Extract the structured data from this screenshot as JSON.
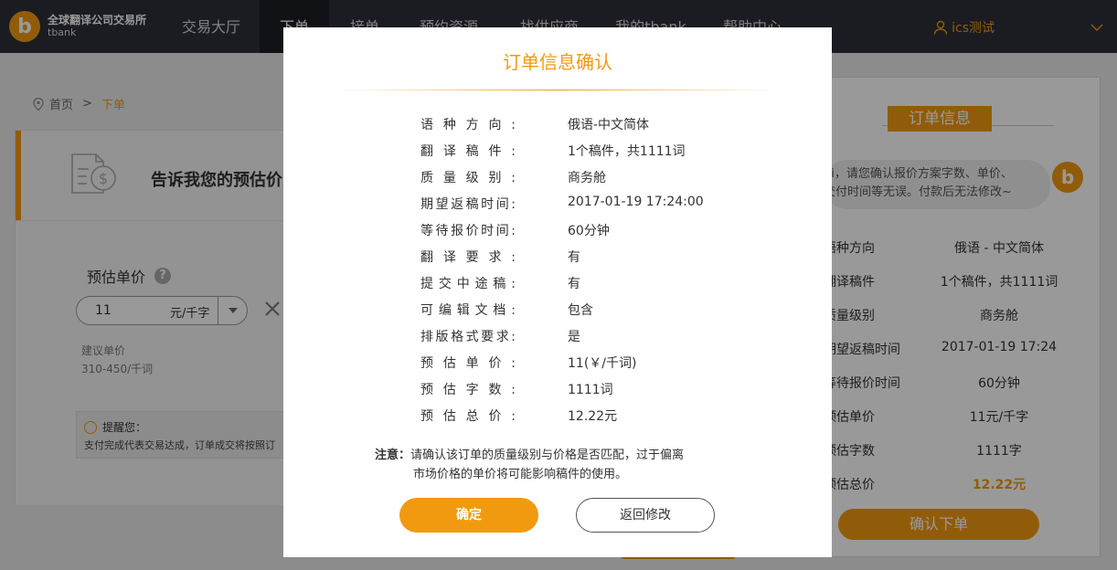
{
  "brand": {
    "logo_glyph": "b",
    "name_cn": "全球翻译公司交易所",
    "name_en": "tbank",
    "accent": "#f29a0f"
  },
  "nav": {
    "items": [
      {
        "label": "交易大厅"
      },
      {
        "label": "下单"
      },
      {
        "label": "接单"
      },
      {
        "label": "预约资源"
      },
      {
        "label": "找供应商"
      },
      {
        "label": "我的tbank"
      },
      {
        "label": "帮助中心"
      }
    ],
    "active_index": 1,
    "user": "ics测试"
  },
  "breadcrumb": {
    "home": "首页",
    "sep": ">",
    "current": "下单"
  },
  "left": {
    "hero_title": "告诉我您的预估价",
    "price_label": "预估单价",
    "price_value": "11",
    "price_unit": "元/千字",
    "suggest_label": "建议单价",
    "suggest_range": "310-450/千词",
    "reminder_title": "提醒您：",
    "reminder_text": "支付完成代表交易达成，订单成交将按照订"
  },
  "right": {
    "title": "订单信息",
    "bubble_line1": "hi，请您确认报价方案字数、单价、",
    "bubble_line2": "交付时间等无误。付款后无法修改~",
    "rows": [
      {
        "k": "语种方向",
        "v": "俄语 - 中文简体"
      },
      {
        "k": "翻译稿件",
        "v": "1个稿件，共1111词"
      },
      {
        "k": "质量级别",
        "v": "商务舱"
      },
      {
        "k": "期望返稿时间",
        "v": "2017-01-19 17:24"
      },
      {
        "k": "等待报价时间",
        "v": "60分钟"
      },
      {
        "k": "预估单价",
        "v": "11元/千字"
      },
      {
        "k": "预估字数",
        "v": "1111字"
      },
      {
        "k": "预估总价",
        "v": "12.22元"
      }
    ],
    "confirm_label": "确认下单"
  },
  "modal": {
    "title": "订单信息确认",
    "rows": [
      {
        "k": "语种方向:",
        "v": "俄语-中文简体"
      },
      {
        "k": "翻译稿件:",
        "v": "1个稿件，共1111词"
      },
      {
        "k": "质量级别:",
        "v": "商务舱"
      },
      {
        "k": "期望返稿时间:",
        "v": "2017-01-19 17:24:00"
      },
      {
        "k": "等待报价时间:",
        "v": "60分钟"
      },
      {
        "k": "翻译要求:",
        "v": "有"
      },
      {
        "k": "提交中途稿:",
        "v": "有"
      },
      {
        "k": "可编辑文档:",
        "v": "包含"
      },
      {
        "k": "排版格式要求:",
        "v": "是"
      },
      {
        "k": "预估单价:",
        "v": "11(￥/千词)"
      },
      {
        "k": "预估字数:",
        "v": "1111词"
      },
      {
        "k": "预估总价:",
        "v": "12.22元"
      }
    ],
    "note_label": "注意：",
    "note_line1": "请确认该订单的质量级别与价格是否匹配，过于偏离",
    "note_line2": "市场价格的单价将可能影响稿件的使用。",
    "ok_label": "确定",
    "back_label": "返回修改"
  },
  "icons": [
    "location-pin-icon",
    "help-icon",
    "close-icon",
    "chevron-down-icon",
    "user-icon",
    "smile-icon",
    "invoice-dollar-icon"
  ]
}
